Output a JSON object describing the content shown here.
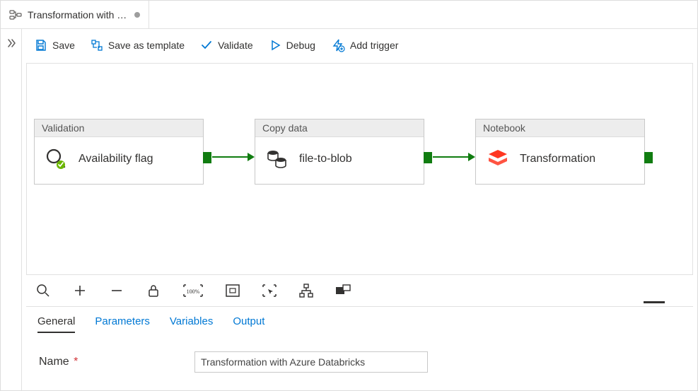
{
  "tab": {
    "title": "Transformation with …"
  },
  "toolbar": {
    "save": "Save",
    "save_as_template": "Save as template",
    "validate": "Validate",
    "debug": "Debug",
    "add_trigger": "Add trigger"
  },
  "nodes": {
    "validation": {
      "header": "Validation",
      "title": "Availability flag"
    },
    "copy": {
      "header": "Copy data",
      "title": "file-to-blob"
    },
    "notebook": {
      "header": "Notebook",
      "title": "Transformation"
    }
  },
  "detail_tabs": {
    "general": "General",
    "parameters": "Parameters",
    "variables": "Variables",
    "output": "Output"
  },
  "form": {
    "name_label": "Name",
    "name_value": "Transformation with Azure Databricks"
  }
}
